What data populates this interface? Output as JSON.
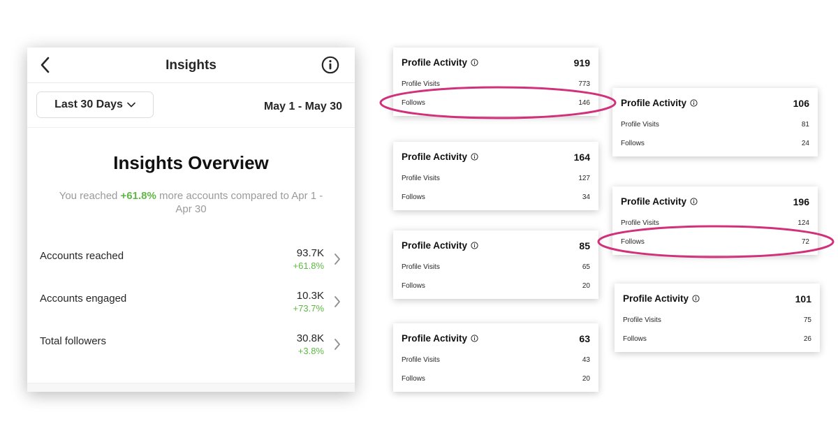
{
  "insights": {
    "header_title": "Insights",
    "date_selector_label": "Last 30 Days",
    "date_range": "May 1 - May 30",
    "overview_title": "Insights Overview",
    "overview_prefix": "You reached ",
    "overview_percent": "+61.8%",
    "overview_suffix": " more accounts compared to Apr 1 - Apr 30",
    "metrics": [
      {
        "label": "Accounts reached",
        "value": "93.7K",
        "change": "+61.8%"
      },
      {
        "label": "Accounts engaged",
        "value": "10.3K",
        "change": "+73.7%"
      },
      {
        "label": "Total followers",
        "value": "30.8K",
        "change": "+3.8%"
      }
    ]
  },
  "cards": [
    {
      "title": "Profile Activity",
      "total": "919",
      "visits_label": "Profile Visits",
      "visits": "773",
      "follows_label": "Follows",
      "follows": "146"
    },
    {
      "title": "Profile Activity",
      "total": "164",
      "visits_label": "Profile Visits",
      "visits": "127",
      "follows_label": "Follows",
      "follows": "34"
    },
    {
      "title": "Profile Activity",
      "total": "85",
      "visits_label": "Profile Visits",
      "visits": "65",
      "follows_label": "Follows",
      "follows": "20"
    },
    {
      "title": "Profile Activity",
      "total": "63",
      "visits_label": "Profile Visits",
      "visits": "43",
      "follows_label": "Follows",
      "follows": "20"
    },
    {
      "title": "Profile Activity",
      "total": "106",
      "visits_label": "Profile Visits",
      "visits": "81",
      "follows_label": "Follows",
      "follows": "24"
    },
    {
      "title": "Profile Activity",
      "total": "196",
      "visits_label": "Profile Visits",
      "visits": "124",
      "follows_label": "Follows",
      "follows": "72"
    },
    {
      "title": "Profile Activity",
      "total": "101",
      "visits_label": "Profile Visits",
      "visits": "75",
      "follows_label": "Follows",
      "follows": "26"
    }
  ],
  "colors": {
    "positive_green": "#5fb844",
    "highlight_magenta": "#d0317a"
  },
  "icons": {
    "back": "chevron-left-icon",
    "info": "info-icon",
    "dropdown": "chevron-down-icon",
    "row_arrow": "chevron-right-icon"
  }
}
